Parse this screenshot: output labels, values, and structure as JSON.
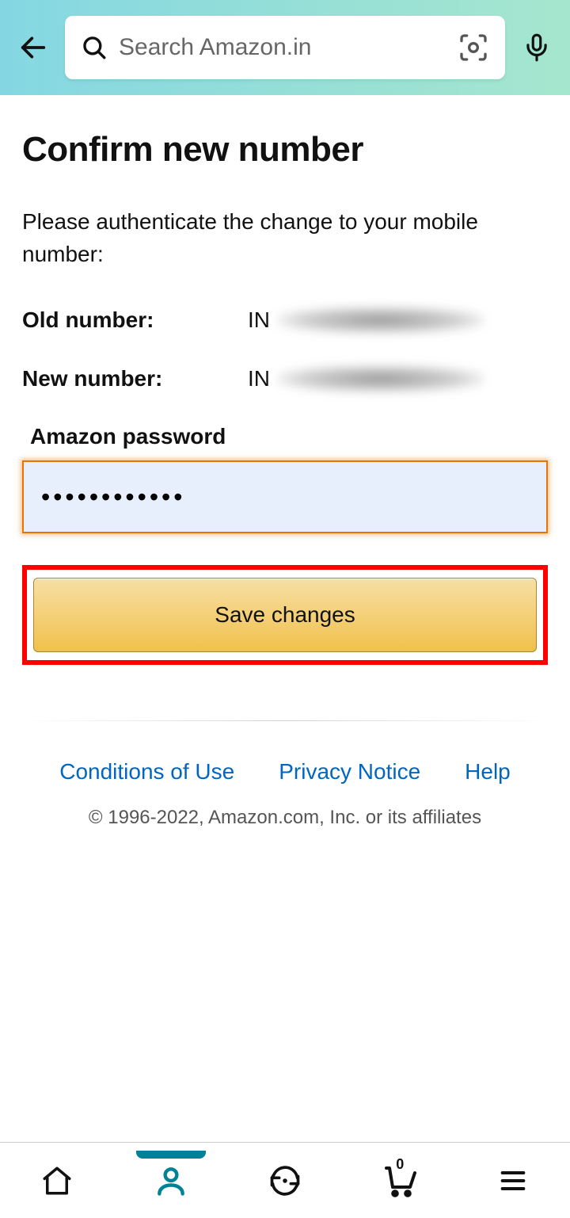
{
  "search": {
    "placeholder": "Search Amazon.in"
  },
  "page": {
    "title": "Confirm new number",
    "instruction": "Please authenticate the change to your mobile number:",
    "old_label": "Old number:",
    "new_label": "New number:",
    "old_prefix": "IN",
    "new_prefix": "IN",
    "pw_label": "Amazon password",
    "pw_value": "••••••••••••",
    "save_label": "Save changes"
  },
  "footer": {
    "conditions": "Conditions of Use",
    "privacy": "Privacy Notice",
    "help": "Help",
    "copyright": "© 1996-2022, Amazon.com, Inc. or its affiliates"
  },
  "nav": {
    "cart_count": "0"
  }
}
